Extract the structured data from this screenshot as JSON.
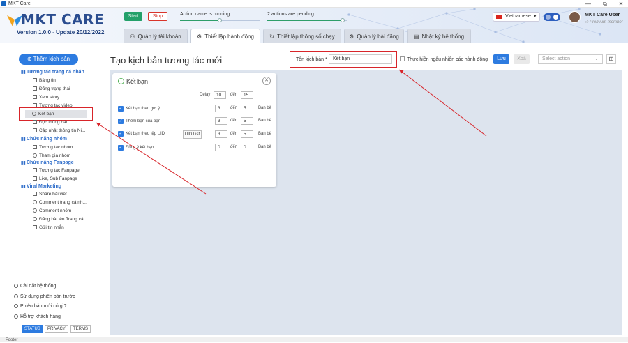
{
  "window": {
    "title": "MKT Care",
    "minimize": "—",
    "maximize": "⧉",
    "close": "✕"
  },
  "brand": {
    "name": "MKT CARE",
    "version": "Version 1.0.0 - Update 20/12/2022",
    "color": "#2b4d8f"
  },
  "controls": {
    "start": "Start",
    "stop": "Stop"
  },
  "progress": [
    {
      "label": "Action name is running...",
      "fraction": 0.5
    },
    {
      "label": "2 actions are pending",
      "fraction": 0.95
    }
  ],
  "language": {
    "label": "Vietnamese",
    "chevron": "▾"
  },
  "user": {
    "name": "MKT Care User",
    "membership": "☆ Premium member"
  },
  "tabs": [
    {
      "label": "Quản lý tài khoản",
      "icon": "people-icon",
      "glyph": "⚇",
      "active": false
    },
    {
      "label": "Thiết lập hành động",
      "icon": "gear-icon",
      "glyph": "⚙",
      "active": true
    },
    {
      "label": "Thiết lập thông số chạy",
      "icon": "refresh-icon",
      "glyph": "↻",
      "active": false
    },
    {
      "label": "Quản lý bài đăng",
      "icon": "gear-icon",
      "glyph": "⚙",
      "active": false
    },
    {
      "label": "Nhật ký hệ thống",
      "icon": "log-icon",
      "glyph": "▤",
      "active": false
    }
  ],
  "sidebar": {
    "add_button": "Thêm kịch bản",
    "add_glyph": "⊕",
    "groups": [
      {
        "title": "Tương tác trang cá nhân",
        "items": [
          "Bảng tin",
          "Đăng trạng thái",
          "Xem story",
          "Tương tác video",
          "Kết bạn",
          "Đọc thông báo",
          "Cập nhật thông tin Ni..."
        ]
      },
      {
        "title": "Chức năng nhóm",
        "items": [
          "Tương tác nhóm",
          "Tham gia nhóm"
        ]
      },
      {
        "title": "Chức năng Fanpage",
        "items": [
          "Tương tác Fanpage",
          "Like, Sub Fanpage"
        ]
      },
      {
        "title": "Viral Marketing",
        "items": [
          "Share bài viết",
          "Comment trang cá nh...",
          "Comment nhóm",
          "Đăng bài lên Trang cá...",
          "Gửi tin nhắn"
        ]
      }
    ],
    "selected": "Kết bạn",
    "footer": [
      "Cài đặt hệ thống",
      "Sử dụng phiên bản trước",
      "Phiên bản mới có gì?",
      "Hỗ trợ khách hàng"
    ],
    "badges": [
      "STATUS",
      "PRIVACY",
      "TERMS"
    ]
  },
  "main": {
    "page_title": "Tạo kịch bản tương tác mới",
    "name_label": "Tên kịch bản *",
    "name_value": "Kết bạn",
    "random_label": "Thực hiện ngẫu nhiên các hành động",
    "save": "Lưu",
    "delete": "Xoá",
    "select_placeholder": "Select action",
    "select_chevron": "⌄",
    "grid_glyph": "⊞"
  },
  "card": {
    "title": "Kết bạn",
    "info_glyph": "i",
    "close_glyph": "✕",
    "check_glyph": "✓",
    "delay": {
      "label": "Delay",
      "from": "10",
      "to_label": "đến",
      "to": "15"
    },
    "rows": [
      {
        "label": "Kết bạn theo gợi ý",
        "from": "3",
        "to_label": "đến",
        "to": "5",
        "unit": "Bạn bè"
      },
      {
        "label": "Thêm bạn của bạn",
        "from": "3",
        "to_label": "đến",
        "to": "5",
        "unit": "Bạn bè"
      },
      {
        "label": "Kết bạn theo tệp UID",
        "button": "UID List",
        "from": "3",
        "to_label": "đến",
        "to": "5",
        "unit": "Bạn bè"
      },
      {
        "label": "Đồng ý kết bạn",
        "from": "0",
        "to_label": "đến",
        "to": "0",
        "unit": "Bạn bè"
      }
    ]
  },
  "footer": "Footer",
  "colors": {
    "primary": "#2d7be0",
    "start": "#23a06a",
    "stop": "#d9342b",
    "highlight": "#d8252a"
  }
}
